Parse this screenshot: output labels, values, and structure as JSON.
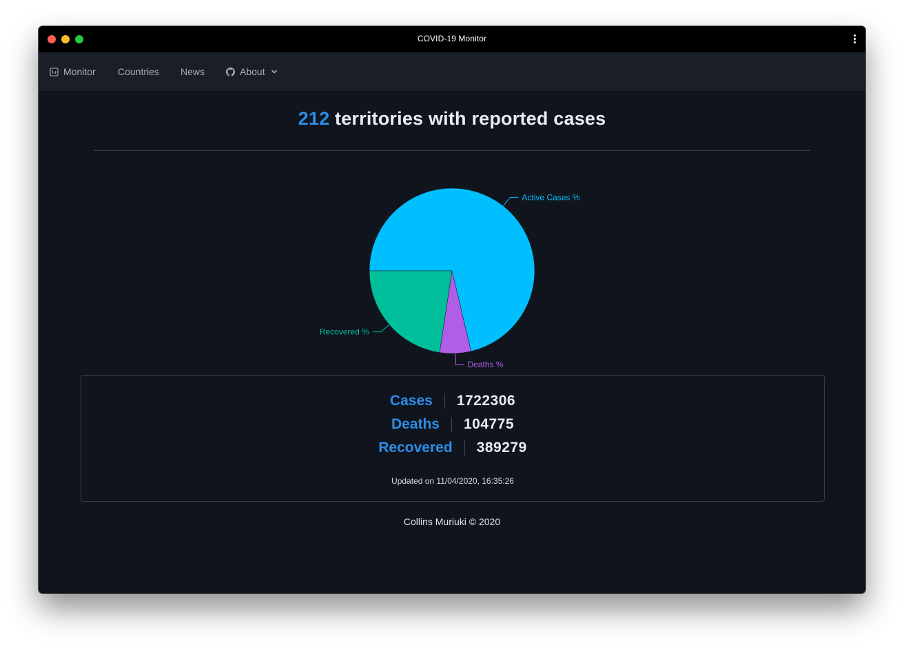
{
  "window": {
    "title": "COVID-19 Monitor"
  },
  "nav": {
    "items": [
      {
        "label": "Monitor",
        "icon": "monitor-icon"
      },
      {
        "label": "Countries"
      },
      {
        "label": "News"
      },
      {
        "label": "About",
        "icon": "github-icon",
        "dropdown_icon": "chevron-down-icon"
      }
    ]
  },
  "header": {
    "count": "212",
    "text": "territories with reported cases"
  },
  "colors": {
    "accent": "#2c8de6",
    "active": "#00bfff",
    "recovered": "#00bf9a",
    "deaths": "#b05ee8",
    "background": "#10141d",
    "navbar": "#1a1e27"
  },
  "chart_data": {
    "type": "pie",
    "labels": [
      "Active Cases %",
      "Deaths %",
      "Recovered %"
    ],
    "values": [
      71.3,
      6.1,
      22.6
    ],
    "colors": [
      "#00bfff",
      "#b05ee8",
      "#00bf9a"
    ]
  },
  "stats": {
    "rows": [
      {
        "label": "Cases",
        "value": "1722306"
      },
      {
        "label": "Deaths",
        "value": "104775"
      },
      {
        "label": "Recovered",
        "value": "389279"
      }
    ],
    "updated": "Updated on 11/04/2020, 16:35:26"
  },
  "footer": {
    "text": "Collins Muriuki © 2020"
  }
}
